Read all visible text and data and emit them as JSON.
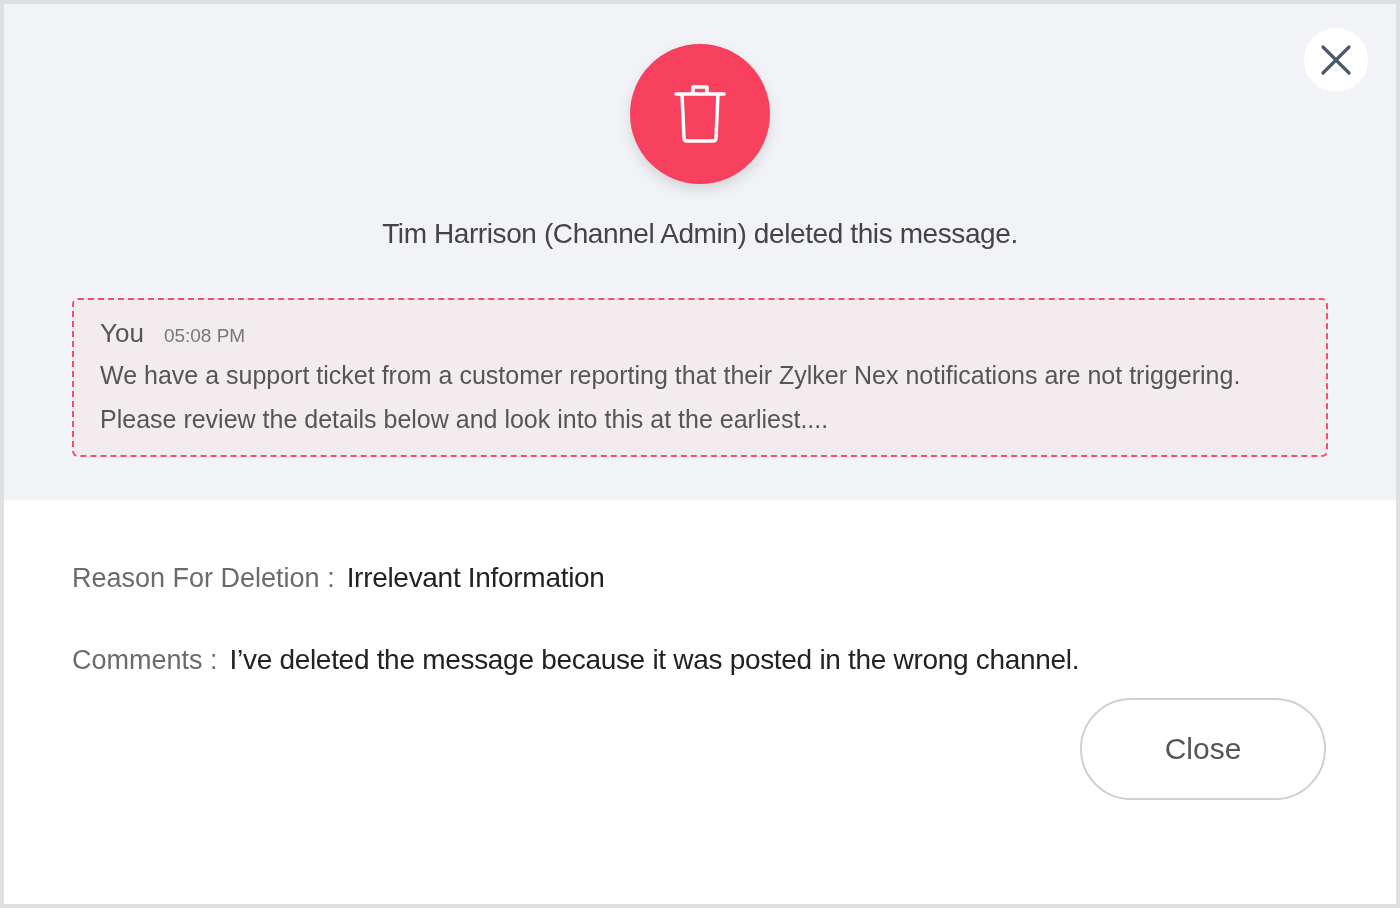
{
  "header": {
    "title": "Tim Harrison (Channel Admin) deleted this message."
  },
  "message": {
    "sender": "You",
    "time": "05:08 PM",
    "text": "We have a support ticket from a customer reporting that their Zylker Nex notifications are not triggering. Please review the details below and look into this at the earliest...."
  },
  "details": [
    {
      "label": "Reason For Deletion :",
      "value": "Irrelevant Information"
    },
    {
      "label": "Comments :",
      "value": "I’ve deleted the message because it was posted in the wrong channel."
    }
  ],
  "buttons": [
    {
      "label": "Close"
    }
  ]
}
